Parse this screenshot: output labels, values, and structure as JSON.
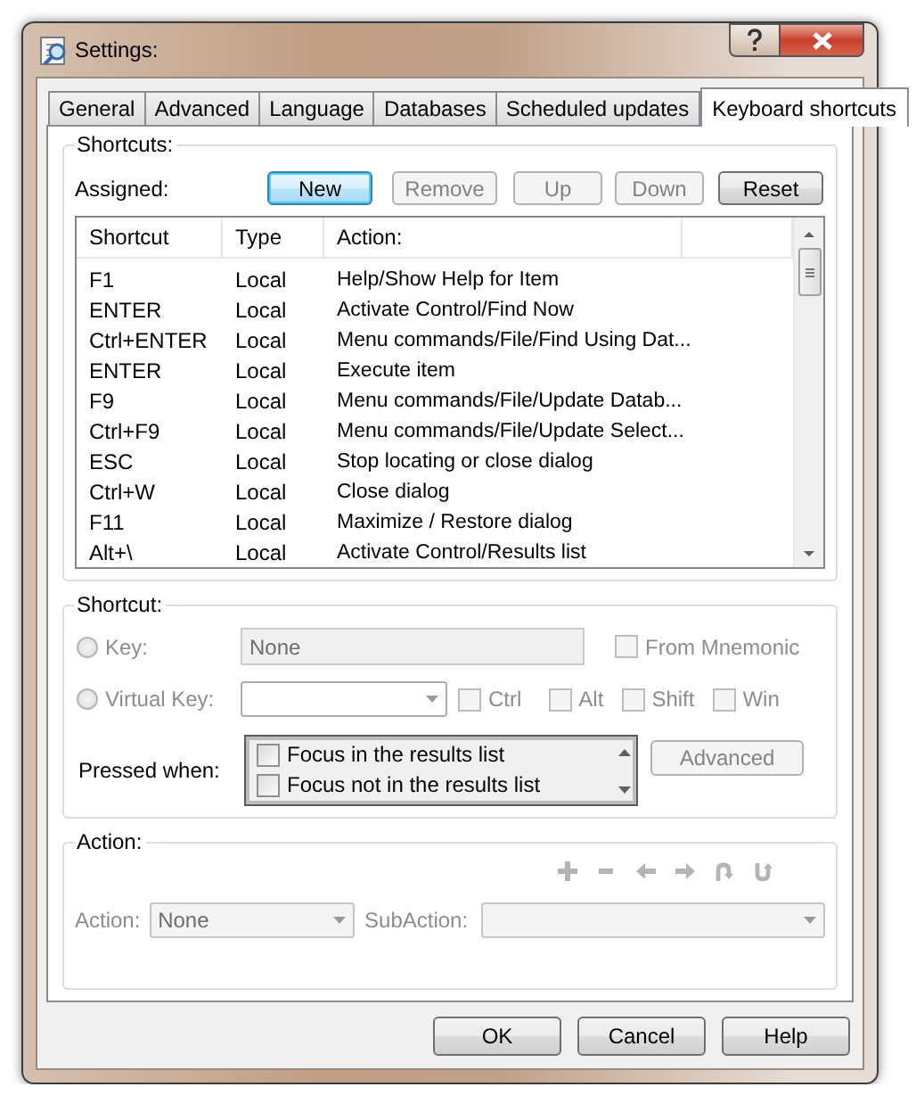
{
  "window": {
    "title": "Settings:"
  },
  "tabs": [
    {
      "label": "General",
      "selected": false
    },
    {
      "label": "Advanced",
      "selected": false
    },
    {
      "label": "Language",
      "selected": false
    },
    {
      "label": "Databases",
      "selected": false
    },
    {
      "label": "Scheduled updates",
      "selected": false
    },
    {
      "label": "Keyboard shortcuts",
      "selected": true
    }
  ],
  "shortcuts": {
    "title": "Shortcuts:",
    "assigned_label": "Assigned:",
    "buttons": [
      {
        "label": "New",
        "disabled": false,
        "focused": true
      },
      {
        "label": "Remove",
        "disabled": true,
        "focused": false
      },
      {
        "label": "Up",
        "disabled": true,
        "focused": false
      },
      {
        "label": "Down",
        "disabled": true,
        "focused": false
      },
      {
        "label": "Reset",
        "disabled": false,
        "focused": false
      }
    ],
    "columns": [
      "Shortcut",
      "Type",
      "Action:"
    ],
    "rows": [
      {
        "shortcut": "F1",
        "type": "Local",
        "action": "Help/Show Help for Item"
      },
      {
        "shortcut": "ENTER",
        "type": "Local",
        "action": "Activate Control/Find Now"
      },
      {
        "shortcut": "Ctrl+ENTER",
        "type": "Local",
        "action": "Menu commands/File/Find Using Dat..."
      },
      {
        "shortcut": "ENTER",
        "type": "Local",
        "action": "Execute item"
      },
      {
        "shortcut": "F9",
        "type": "Local",
        "action": "Menu commands/File/Update Datab..."
      },
      {
        "shortcut": "Ctrl+F9",
        "type": "Local",
        "action": "Menu commands/File/Update Select..."
      },
      {
        "shortcut": "ESC",
        "type": "Local",
        "action": "Stop locating or close dialog"
      },
      {
        "shortcut": "Ctrl+W",
        "type": "Local",
        "action": "Close dialog"
      },
      {
        "shortcut": "F11",
        "type": "Local",
        "action": "Maximize / Restore dialog"
      },
      {
        "shortcut": "Alt+\\",
        "type": "Local",
        "action": "Activate Control/Results list"
      }
    ]
  },
  "shortcut": {
    "title": "Shortcut:",
    "key": {
      "label": "Key:",
      "selected": false,
      "disabled": true
    },
    "key_field": {
      "value": "None",
      "disabled": true
    },
    "from_mnemonic": {
      "label": "From Mnemonic",
      "checked": false,
      "disabled": true
    },
    "virtual_key": {
      "label": "Virtual Key:",
      "selected": false,
      "disabled": true
    },
    "modifiers": [
      {
        "label": "Ctrl",
        "checked": false,
        "disabled": true
      },
      {
        "label": "Alt",
        "checked": false,
        "disabled": true
      },
      {
        "label": "Shift",
        "checked": false,
        "disabled": true
      },
      {
        "label": "Win",
        "checked": false,
        "disabled": true
      }
    ],
    "pressed_when_label": "Pressed when:",
    "conditions": [
      {
        "label": "Focus in the results list",
        "checked": false
      },
      {
        "label": "Focus not in the results list",
        "checked": false
      }
    ],
    "advanced_button": {
      "label": "Advanced",
      "disabled": true
    }
  },
  "action": {
    "title": "Action:",
    "toolbar_disabled": true,
    "action_label": "Action:",
    "action_value": "None",
    "subaction_label": "SubAction:",
    "disabled": true
  },
  "footer_buttons": [
    "OK",
    "Cancel",
    "Help"
  ]
}
